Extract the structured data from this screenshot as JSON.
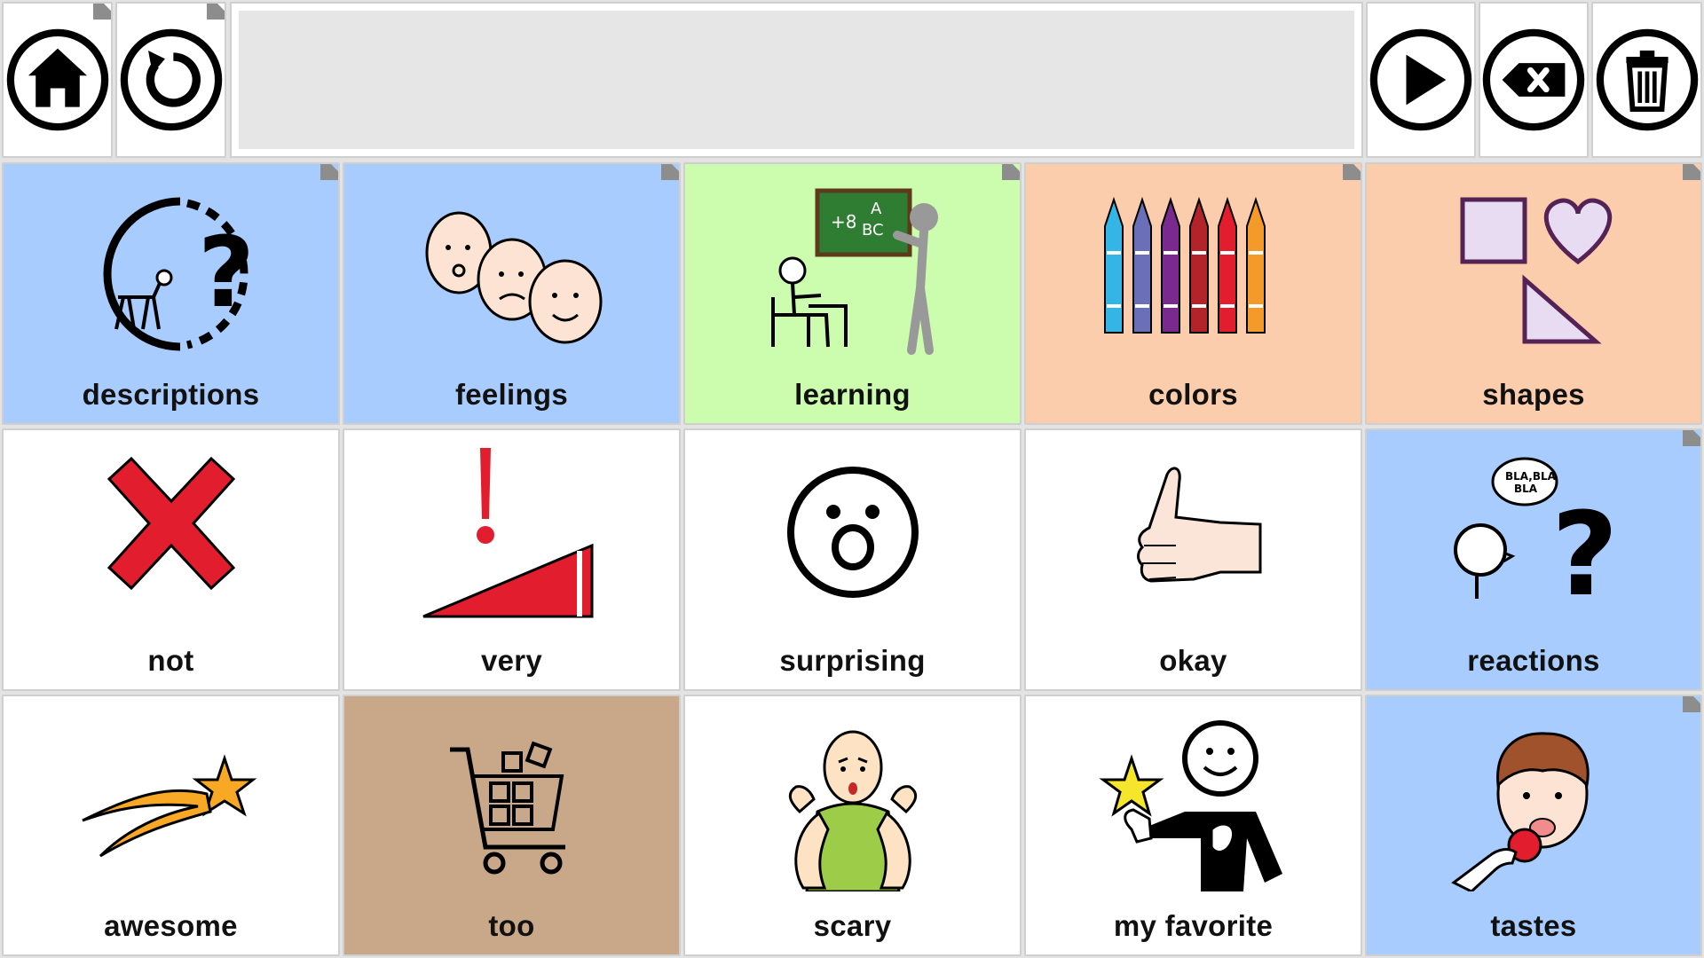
{
  "toolbar": {
    "home": "home-icon",
    "back": "back-icon",
    "speak": "play-icon",
    "backspace": "backspace-icon",
    "clear": "trash-icon"
  },
  "message_bar": {
    "text": ""
  },
  "colors": {
    "blue": "#a9ccff",
    "green": "#ccfcad",
    "peach": "#fccdad",
    "tan": "#c8a888",
    "white": "#ffffff"
  },
  "tiles": [
    {
      "label": "descriptions",
      "color": "blue",
      "folder": true
    },
    {
      "label": "feelings",
      "color": "blue",
      "folder": true
    },
    {
      "label": "learning",
      "color": "green",
      "folder": true
    },
    {
      "label": "colors",
      "color": "peach",
      "folder": true
    },
    {
      "label": "shapes",
      "color": "peach",
      "folder": true
    },
    {
      "label": "not",
      "color": "white",
      "folder": false
    },
    {
      "label": "very",
      "color": "white",
      "folder": false
    },
    {
      "label": "surprising",
      "color": "white",
      "folder": false
    },
    {
      "label": "okay",
      "color": "white",
      "folder": false
    },
    {
      "label": "reactions",
      "color": "blue",
      "folder": true
    },
    {
      "label": "awesome",
      "color": "white",
      "folder": false
    },
    {
      "label": "too",
      "color": "tan",
      "folder": false
    },
    {
      "label": "scary",
      "color": "white",
      "folder": false
    },
    {
      "label": "my favorite",
      "color": "white",
      "folder": false
    },
    {
      "label": "tastes",
      "color": "blue",
      "folder": true
    }
  ]
}
